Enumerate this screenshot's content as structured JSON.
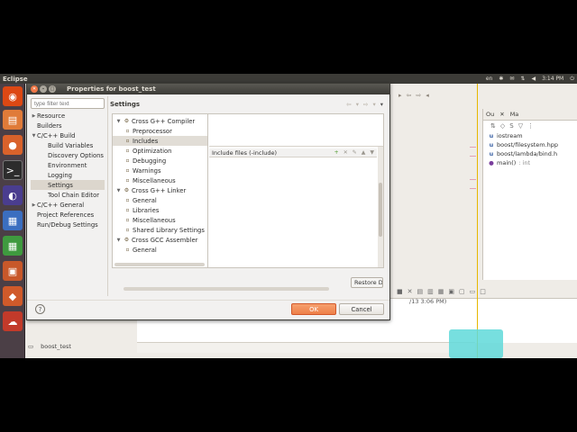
{
  "top_panel": {
    "app_title": "Eclipse",
    "keyboard": "en",
    "time": "3:14 PM"
  },
  "launcher_icons": [
    "ubuntu-dash-icon",
    "files-icon",
    "firefox-icon",
    "terminal-icon",
    "eclipse-icon",
    "writer-icon",
    "calc-icon",
    "impress-icon",
    "software-center-icon",
    "ubuntu-one-icon"
  ],
  "dialog": {
    "title": "Properties for boost_test",
    "filter_placeholder": "type filter text",
    "nav": [
      {
        "label": "Resource",
        "level": 0,
        "twisty": "▶"
      },
      {
        "label": "Builders",
        "level": 0,
        "twisty": ""
      },
      {
        "label": "C/C++ Build",
        "level": 0,
        "twisty": "▼"
      },
      {
        "label": "Build Variables",
        "level": 1,
        "twisty": ""
      },
      {
        "label": "Discovery Options",
        "level": 1,
        "twisty": ""
      },
      {
        "label": "Environment",
        "level": 1,
        "twisty": ""
      },
      {
        "label": "Logging",
        "level": 1,
        "twisty": ""
      },
      {
        "label": "Settings",
        "level": 1,
        "twisty": "",
        "selected": true
      },
      {
        "label": "Tool Chain Editor",
        "level": 1,
        "twisty": ""
      },
      {
        "label": "C/C++ General",
        "level": 0,
        "twisty": "▶"
      },
      {
        "label": "Project References",
        "level": 0,
        "twisty": ""
      },
      {
        "label": "Run/Debug Settings",
        "level": 0,
        "twisty": ""
      }
    ],
    "settings_title": "Settings",
    "tool_tree": [
      {
        "label": "Cross G++ Compiler",
        "level": 0,
        "twisty": "▼"
      },
      {
        "label": "Preprocessor",
        "level": 1
      },
      {
        "label": "Includes",
        "level": 1,
        "selected": true
      },
      {
        "label": "Optimization",
        "level": 1
      },
      {
        "label": "Debugging",
        "level": 1
      },
      {
        "label": "Warnings",
        "level": 1
      },
      {
        "label": "Miscellaneous",
        "level": 1
      },
      {
        "label": "Cross G++ Linker",
        "level": 0,
        "twisty": "▼"
      },
      {
        "label": "General",
        "level": 1
      },
      {
        "label": "Libraries",
        "level": 1
      },
      {
        "label": "Miscellaneous",
        "level": 1
      },
      {
        "label": "Shared Library Settings",
        "level": 1
      },
      {
        "label": "Cross GCC Assembler",
        "level": 0,
        "twisty": "▼"
      },
      {
        "label": "General",
        "level": 1
      }
    ],
    "include_files_label": "Include files (-include)",
    "restore_label": "Restore D",
    "ok_label": "OK",
    "cancel_label": "Cancel",
    "help_glyph": "?"
  },
  "outline": {
    "tab_outline": "Ou",
    "tab_make": "Ma",
    "items": [
      {
        "icon": "include-icon",
        "label": "iostream"
      },
      {
        "icon": "include-icon",
        "label": "boost/filesystem.hpp"
      },
      {
        "icon": "include-icon",
        "label": "boost/lambda/bind.h"
      },
      {
        "icon": "method-icon",
        "label": "main()",
        "suffix": ": int"
      }
    ]
  },
  "console": {
    "date_fragment": "/13 3:06 PM)"
  },
  "project_explorer": {
    "item": "boost_test"
  }
}
